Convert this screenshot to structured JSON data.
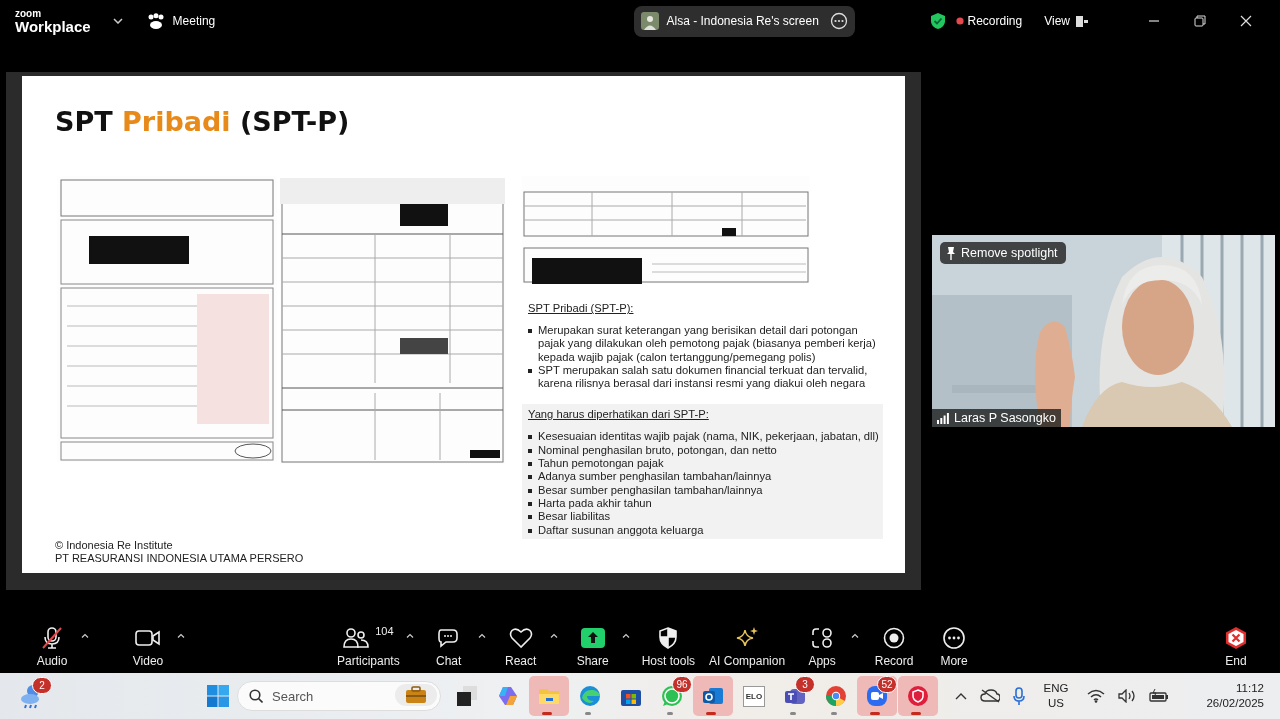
{
  "topbar": {
    "logo_top": "zoom",
    "logo_bottom": "Workplace",
    "meeting_label": "Meeting",
    "share_title": "Alsa - Indonesia Re's screen",
    "recording_label": "Recording",
    "view_label": "View"
  },
  "slide": {
    "title": [
      {
        "text": "SPT ",
        "accent": false
      },
      {
        "text": "Pribadi",
        "accent": true
      },
      {
        "text": " (SPT-P)",
        "accent": false
      }
    ],
    "scans": [
      {
        "kind": "picture"
      },
      {
        "kind": "picture"
      },
      {
        "kind": "picture"
      }
    ],
    "section1": {
      "heading": "SPT Pribadi (SPT-P):",
      "bullets": [
        "Merupakan surat keterangan yang berisikan detail dari potongan pajak yang dilakukan oleh pemotong pajak (biasanya pemberi kerja) kepada wajib pajak (calon tertanggung/pemegang polis)",
        "SPT merupakan salah satu dokumen financial terkuat dan tervalid, karena rilisnya berasal dari instansi resmi yang diakui oleh negara"
      ]
    },
    "section2": {
      "heading": "Yang harus diperhatikan dari SPT-P:",
      "bullets": [
        "Kesesuaian identitas wajib pajak (nama, NIK, pekerjaan, jabatan, dll)",
        "Nominal penghasilan bruto, potongan, dan netto",
        "Tahun pemotongan pajak",
        "Adanya sumber penghasilan tambahan/lainnya",
        "Besar sumber penghasilan tambahan/lainnya",
        "Harta pada akhir tahun",
        "Besar liabilitas",
        "Daftar susunan anggota keluarga"
      ]
    },
    "footer": [
      "© Indonesia Re Institute",
      "PT REASURANSI INDONESIA UTAMA PERSERO"
    ]
  },
  "video": {
    "spotlight_button": "Remove spotlight",
    "participant_name": "Laras P Sasongko"
  },
  "toolbar": {
    "left": [
      {
        "kind": "audio",
        "label": "Audio",
        "muted": true,
        "caret": true
      },
      {
        "kind": "video",
        "label": "Video",
        "caret": true
      }
    ],
    "center": [
      {
        "kind": "participants",
        "label": "Participants",
        "count": "104",
        "caret": true
      },
      {
        "kind": "chat",
        "label": "Chat",
        "caret": true
      },
      {
        "kind": "react",
        "label": "React",
        "caret": true
      },
      {
        "kind": "share",
        "label": "Share",
        "caret": true
      },
      {
        "kind": "host",
        "label": "Host tools",
        "caret": false
      },
      {
        "kind": "ai",
        "label": "AI Companion",
        "caret": false
      },
      {
        "kind": "apps",
        "label": "Apps",
        "caret": true
      },
      {
        "kind": "record",
        "label": "Record",
        "caret": false
      },
      {
        "kind": "more",
        "label": "More",
        "caret": false
      }
    ],
    "end_label": "End"
  },
  "taskbar": {
    "weather_badge": "2",
    "search_placeholder": "Search",
    "apps": [
      {
        "kind": "taskview",
        "highlighted": false,
        "running": false
      },
      {
        "kind": "copilot",
        "highlighted": false,
        "running": false
      },
      {
        "kind": "explorer",
        "highlighted": true,
        "running": true
      },
      {
        "kind": "edge",
        "highlighted": false,
        "running": true
      },
      {
        "kind": "store",
        "highlighted": false,
        "running": false
      },
      {
        "kind": "whatsapp",
        "badge": "96",
        "highlighted": false,
        "running": true
      },
      {
        "kind": "outlook",
        "highlighted": true,
        "running": true
      },
      {
        "kind": "elo",
        "label": "ELO",
        "highlighted": false,
        "running": false
      },
      {
        "kind": "teams",
        "badge": "3",
        "highlighted": false,
        "running": true
      },
      {
        "kind": "chrome",
        "highlighted": false,
        "running": true
      },
      {
        "kind": "zoom",
        "badge": "52",
        "highlighted": true,
        "running": true
      },
      {
        "kind": "shield",
        "highlighted": true,
        "running": true
      }
    ],
    "tray": {
      "lang_top": "ENG",
      "lang_bottom": "US",
      "time": "11:12",
      "date": "26/02/2025"
    }
  }
}
